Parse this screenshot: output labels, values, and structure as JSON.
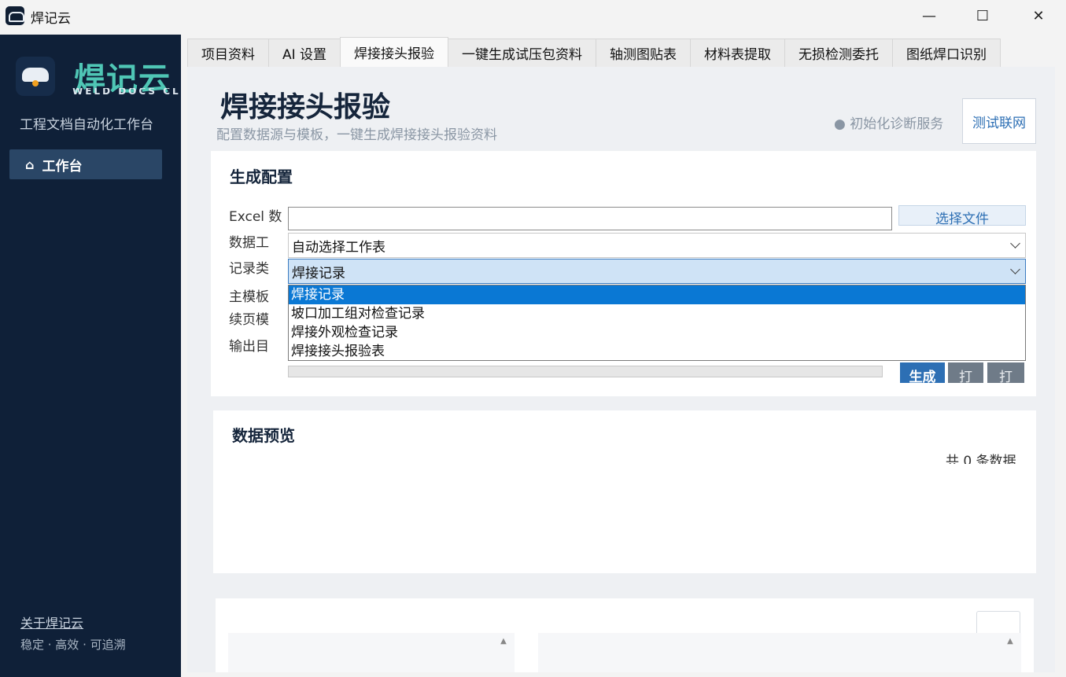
{
  "window": {
    "title": "焊记云",
    "minimize": "—",
    "maximize": "☐",
    "close": "✕"
  },
  "sidebar": {
    "logo_text": "焊记云",
    "logo_sub": "WELD DOCS CL",
    "tagline": "工程文档自动化工作台",
    "nav": [
      {
        "label": "工作台",
        "icon": "home-icon",
        "glyph": "⌂"
      }
    ],
    "about": "关于焊记云",
    "motto": "稳定 · 高效 · 可追溯"
  },
  "tabs": [
    {
      "label": "项目资料",
      "active": false
    },
    {
      "label": "AI 设置",
      "active": false
    },
    {
      "label": "焊接接头报验",
      "active": true
    },
    {
      "label": "一键生成试压包资料",
      "active": false
    },
    {
      "label": "轴测图贴表",
      "active": false
    },
    {
      "label": "材料表提取",
      "active": false
    },
    {
      "label": "无损检测委托",
      "active": false
    },
    {
      "label": "图纸焊口识别",
      "active": false
    }
  ],
  "header": {
    "title": "焊接接头报验",
    "subtitle": "配置数据源与模板，一键生成焊接接头报验资料",
    "status": "● 初始化诊断服务",
    "test_button": "测试联网"
  },
  "config": {
    "title": "生成配置",
    "labels": {
      "excel": "Excel 数",
      "sheet": "数据工",
      "record_type": "记录类",
      "main_template": "主模板",
      "cont_template": "续页模",
      "output_dir": "输出目"
    },
    "excel_value": "",
    "choose_file_button": "选择文件",
    "sheet_value": "自动选择工作表",
    "record_type_value": "焊接记录",
    "record_type_options": [
      "焊接记录",
      "坡口加工组对检查记录",
      "焊接外观检查记录",
      "焊接接头报验表"
    ],
    "generate_button": "生成",
    "print_button_1": "打",
    "print_button_2": "打"
  },
  "preview": {
    "title": "数据预览",
    "count": "共 0 条数据"
  },
  "colors": {
    "sidebar_bg": "#0f2038",
    "accent": "#2d6fb4",
    "logo_teal": "#4fc6b5",
    "dropdown_selected": "#0a78d4"
  }
}
